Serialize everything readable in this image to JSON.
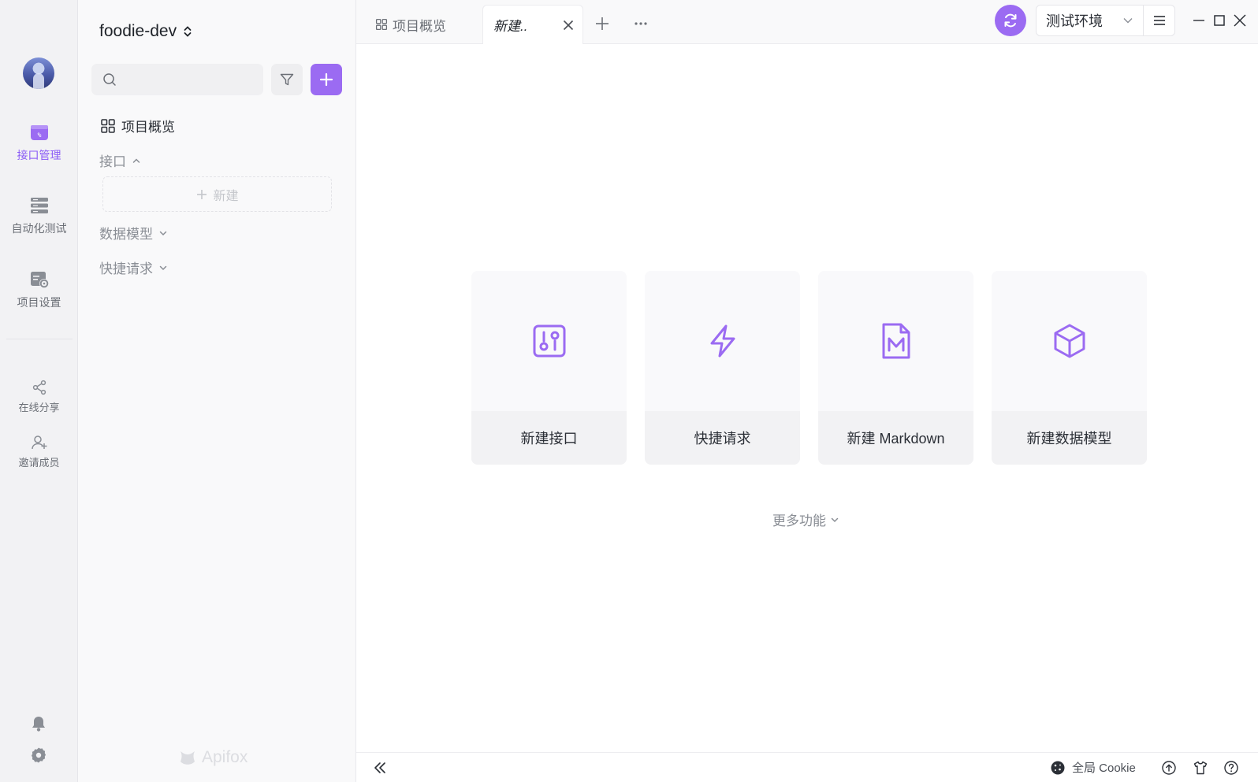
{
  "rail": {
    "items": [
      {
        "label": "接口管理",
        "icon": "api-folder-icon",
        "active": true
      },
      {
        "label": "自动化测试",
        "icon": "server-stack-icon"
      },
      {
        "label": "项目设置",
        "icon": "project-settings-icon"
      }
    ],
    "secondary": [
      {
        "label": "在线分享",
        "icon": "share-icon"
      },
      {
        "label": "邀请成员",
        "icon": "invite-user-icon"
      }
    ]
  },
  "sidebar": {
    "project_name": "foodie-dev",
    "search_placeholder": "",
    "overview_label": "项目概览",
    "sections": {
      "api": "接口",
      "data_model": "数据模型",
      "quick_request": "快捷请求"
    },
    "new_label": "新建",
    "brand": "Apifox"
  },
  "tabs": {
    "overview": "项目概览",
    "new": "新建..",
    "environment": "测试环境"
  },
  "cards": [
    {
      "label": "新建接口",
      "icon": "new-api-icon"
    },
    {
      "label": "快捷请求",
      "icon": "lightning-icon"
    },
    {
      "label": "新建 Markdown",
      "icon": "markdown-file-icon"
    },
    {
      "label": "新建数据模型",
      "icon": "cube-icon"
    }
  ],
  "more_label": "更多功能",
  "bottom": {
    "cookie_label": "全局 Cookie"
  },
  "colors": {
    "accent": "#9b6bf2",
    "active_text": "#8b5cf6"
  }
}
